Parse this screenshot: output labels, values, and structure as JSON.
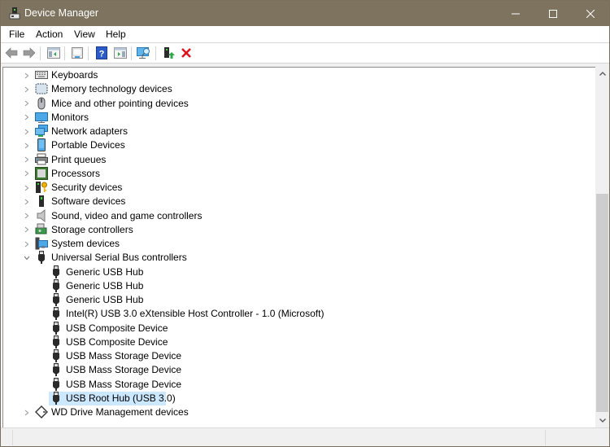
{
  "window": {
    "title": "Device Manager",
    "controls": {
      "minimize": "minimize",
      "maximize": "maximize",
      "close": "close"
    }
  },
  "menu": [
    {
      "label": "File"
    },
    {
      "label": "Action"
    },
    {
      "label": "View"
    },
    {
      "label": "Help"
    }
  ],
  "toolbar": [
    {
      "name": "back",
      "icon": "back-arrow-icon"
    },
    {
      "name": "forward",
      "icon": "forward-arrow-icon"
    },
    {
      "name": "show-hide-console-tree",
      "icon": "console-tree-icon"
    },
    {
      "name": "properties",
      "icon": "properties-icon"
    },
    {
      "name": "help",
      "icon": "help-icon"
    },
    {
      "name": "show-hide-action-pane",
      "icon": "action-pane-icon"
    },
    {
      "name": "scan-hardware-changes",
      "icon": "scan-monitor-icon"
    },
    {
      "name": "update-driver",
      "icon": "update-driver-icon"
    },
    {
      "name": "uninstall-device",
      "icon": "uninstall-x-icon"
    }
  ],
  "tree": {
    "categories": [
      {
        "label": "Keyboards",
        "icon": "keyboard-icon",
        "expanded": false
      },
      {
        "label": "Memory technology devices",
        "icon": "memory-icon",
        "expanded": false
      },
      {
        "label": "Mice and other pointing devices",
        "icon": "mouse-icon",
        "expanded": false
      },
      {
        "label": "Monitors",
        "icon": "monitor-icon",
        "expanded": false
      },
      {
        "label": "Network adapters",
        "icon": "network-icon",
        "expanded": false
      },
      {
        "label": "Portable Devices",
        "icon": "portable-device-icon",
        "expanded": false
      },
      {
        "label": "Print queues",
        "icon": "printer-icon",
        "expanded": false
      },
      {
        "label": "Processors",
        "icon": "processor-icon",
        "expanded": false
      },
      {
        "label": "Security devices",
        "icon": "security-device-icon",
        "expanded": false
      },
      {
        "label": "Software devices",
        "icon": "software-device-icon",
        "expanded": false
      },
      {
        "label": "Sound, video and game controllers",
        "icon": "speaker-icon",
        "expanded": false
      },
      {
        "label": "Storage controllers",
        "icon": "storage-controller-icon",
        "expanded": false
      },
      {
        "label": "System devices",
        "icon": "system-device-icon",
        "expanded": false
      },
      {
        "label": "Universal Serial Bus controllers",
        "icon": "usb-icon",
        "expanded": true
      },
      {
        "label": "WD Drive Management devices",
        "icon": "wd-drive-icon",
        "expanded": false
      }
    ],
    "usb_children": [
      {
        "label": "Generic USB Hub",
        "selected": false
      },
      {
        "label": "Generic USB Hub",
        "selected": false
      },
      {
        "label": "Generic USB Hub",
        "selected": false
      },
      {
        "label": "Intel(R) USB 3.0 eXtensible Host Controller - 1.0 (Microsoft)",
        "selected": false
      },
      {
        "label": "USB Composite Device",
        "selected": false
      },
      {
        "label": "USB Composite Device",
        "selected": false
      },
      {
        "label": "USB Mass Storage Device",
        "selected": false
      },
      {
        "label": "USB Mass Storage Device",
        "selected": false
      },
      {
        "label": "USB Mass Storage Device",
        "selected": false
      },
      {
        "label": "USB Root Hub (USB 3.0)",
        "selected": true
      }
    ]
  },
  "colors": {
    "titlebar": "#7d735f",
    "selection": "#cce8ff",
    "scroll_thumb": "#cdcdcd"
  }
}
